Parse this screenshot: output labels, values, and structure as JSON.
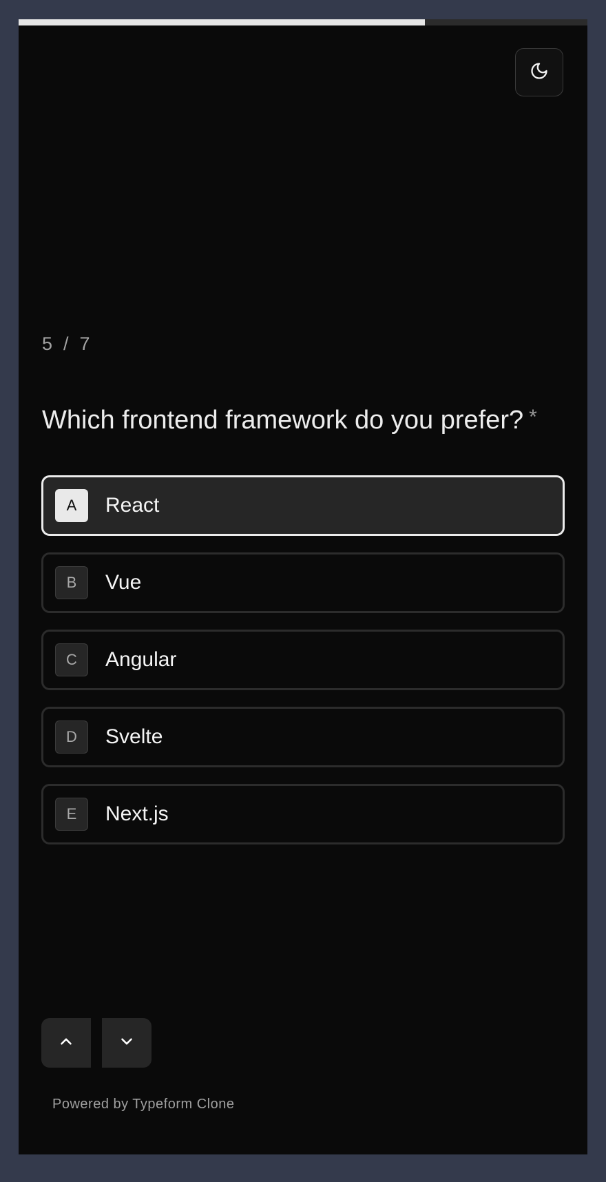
{
  "progress": {
    "fraction": 0.714
  },
  "theme_toggle": {
    "icon": "moon-icon"
  },
  "counter": {
    "current": "5",
    "separator": "/",
    "total": "7"
  },
  "question": {
    "text": "Which frontend framework do you prefer?",
    "required_mark": "*"
  },
  "options": [
    {
      "key": "A",
      "label": "React",
      "selected": true
    },
    {
      "key": "B",
      "label": "Vue",
      "selected": false
    },
    {
      "key": "C",
      "label": "Angular",
      "selected": false
    },
    {
      "key": "D",
      "label": "Svelte",
      "selected": false
    },
    {
      "key": "E",
      "label": "Next.js",
      "selected": false
    }
  ],
  "navigation": {
    "up_icon": "chevron-up-icon",
    "down_icon": "chevron-down-icon"
  },
  "footer": {
    "text": "Powered by Typeform Clone"
  },
  "colors": {
    "background": "#0a0a0a",
    "outer": "#343a4c",
    "accent": "#e6e6e6"
  }
}
